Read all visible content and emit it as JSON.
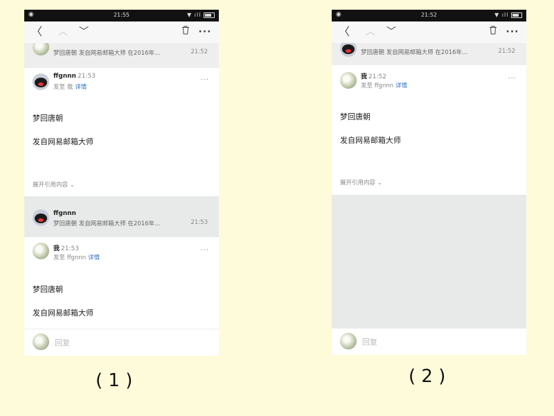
{
  "background_color": "#fdfbd9",
  "link_color": "#2b74c4",
  "toolbar_icons": [
    "back-chevron-icon",
    "up-chevron-icon",
    "down-chevron-icon",
    "trash-icon",
    "more-icon"
  ],
  "phone1": {
    "status_time": "21:55",
    "top_snippet": {
      "text": "梦回唐朝 发自网易邮箱大师 在2016年...",
      "time": "21:52"
    },
    "message1": {
      "sender": "ffgnnn",
      "time": "21:53",
      "to_label": "发至 我",
      "details_link": "详情",
      "body_lines": [
        "梦回唐朝",
        "发自网易邮箱大师"
      ],
      "expand_quote": "展开引用内容 ⌄"
    },
    "collapsed": {
      "sender": "ffgnnn",
      "snippet": "梦回唐朝 发自网易邮箱大师 在2016年...",
      "time": "21:53"
    },
    "message2": {
      "sender": "我",
      "time": "21:53",
      "to_label": "发至 ffgnnn",
      "details_link": "详情",
      "body_lines": [
        "梦回唐朝",
        "发自网易邮箱大师"
      ]
    },
    "reply_label": "回复"
  },
  "phone2": {
    "status_time": "21:52",
    "top_snippet": {
      "text": "梦回唐朝 发自网易邮箱大师 在2016年...",
      "time": "21:52"
    },
    "message1": {
      "sender": "我",
      "time": "21:52",
      "to_label": "发至 ffgnnn",
      "details_link": "详情",
      "body_lines": [
        "梦回唐朝",
        "发自网易邮箱大师"
      ],
      "expand_quote": "展开引用内容 ⌄"
    },
    "reply_label": "回复"
  },
  "captions": [
    "( 1 )",
    "( 2 )"
  ]
}
